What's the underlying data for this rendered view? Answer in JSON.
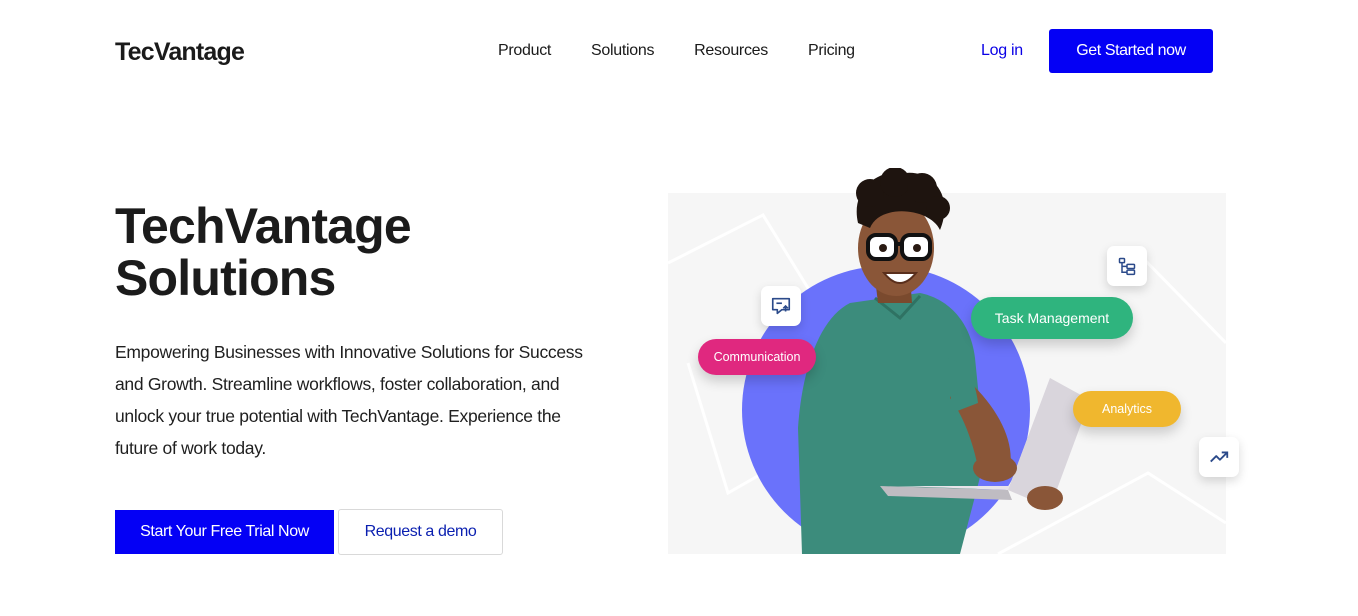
{
  "header": {
    "logo": "TecVantage",
    "nav": [
      "Product",
      "Solutions",
      "Resources",
      "Pricing"
    ],
    "login_label": "Log in",
    "cta_label": "Get Started now"
  },
  "hero": {
    "title_line1": "TechVantage",
    "title_line2": "Solutions",
    "description": "Empowering Businesses with Innovative Solutions for Success and Growth. Streamline workflows, foster collaboration, and unlock your true potential with TechVantage. Experience the future of work today.",
    "primary_button": "Start Your Free Trial Now",
    "secondary_button": "Request a demo"
  },
  "illustration": {
    "tags": {
      "communication": "Communication",
      "task_management": "Task Management",
      "analytics": "Analytics"
    },
    "icons": [
      "chat-upload-icon",
      "hierarchy-icon",
      "trending-up-icon"
    ],
    "colors": {
      "communication": "#e0287f",
      "task_management": "#2fb47e",
      "analytics": "#f0b72e",
      "circle": "#6a72fb",
      "brand_blue": "#0400f5"
    }
  }
}
